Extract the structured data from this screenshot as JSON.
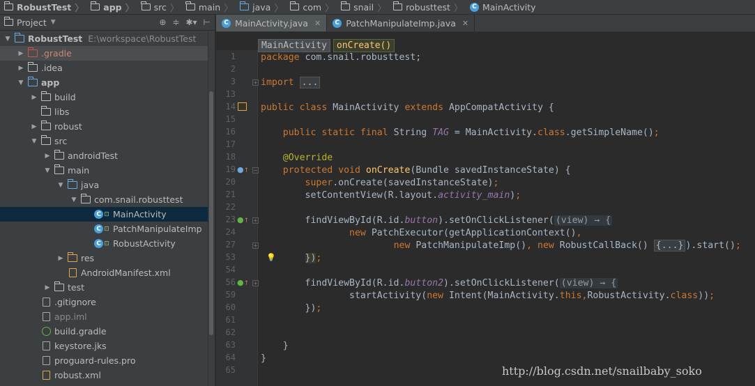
{
  "breadcrumbs": [
    {
      "label": "RobustTest",
      "icon": "project-folder-icon",
      "bold": true
    },
    {
      "label": "app",
      "icon": "module-folder-icon",
      "bold": true
    },
    {
      "label": "src",
      "icon": "folder-icon"
    },
    {
      "label": "main",
      "icon": "folder-icon"
    },
    {
      "label": "java",
      "icon": "source-folder-icon"
    },
    {
      "label": "com",
      "icon": "package-folder-icon"
    },
    {
      "label": "snail",
      "icon": "package-folder-icon"
    },
    {
      "label": "robusttest",
      "icon": "package-folder-icon"
    },
    {
      "label": "MainActivity",
      "icon": "class-icon"
    }
  ],
  "project": {
    "title": "Project",
    "tree": [
      {
        "depth": 0,
        "arrow": "down",
        "icon": "module",
        "label": "RobustTest",
        "bold": true,
        "path": "E:\\workspace\\RobustTest"
      },
      {
        "depth": 1,
        "arrow": "right",
        "icon": "folder-red",
        "label": ".gradle",
        "style": "red",
        "soft": true
      },
      {
        "depth": 1,
        "arrow": "right",
        "icon": "folder",
        "label": ".idea"
      },
      {
        "depth": 1,
        "arrow": "down",
        "icon": "module",
        "label": "app",
        "bold": true
      },
      {
        "depth": 2,
        "arrow": "right",
        "icon": "folder",
        "label": "build"
      },
      {
        "depth": 2,
        "arrow": "",
        "icon": "folder",
        "label": "libs"
      },
      {
        "depth": 2,
        "arrow": "right",
        "icon": "folder",
        "label": "robust"
      },
      {
        "depth": 2,
        "arrow": "down",
        "icon": "folder",
        "label": "src"
      },
      {
        "depth": 3,
        "arrow": "right",
        "icon": "folder",
        "label": "androidTest"
      },
      {
        "depth": 3,
        "arrow": "down",
        "icon": "folder",
        "label": "main"
      },
      {
        "depth": 4,
        "arrow": "down",
        "icon": "folder-blue",
        "label": "java"
      },
      {
        "depth": 5,
        "arrow": "down",
        "icon": "folder",
        "label": "com.snail.robusttest"
      },
      {
        "depth": 6,
        "arrow": "",
        "icon": "class",
        "label": "MainActivity",
        "selected": true
      },
      {
        "depth": 6,
        "arrow": "",
        "icon": "class",
        "label": "PatchManipulateImp"
      },
      {
        "depth": 6,
        "arrow": "",
        "icon": "class",
        "label": "RobustActivity"
      },
      {
        "depth": 4,
        "arrow": "right",
        "icon": "folder-orange",
        "label": "res"
      },
      {
        "depth": 4,
        "arrow": "",
        "icon": "xml",
        "label": "AndroidManifest.xml"
      },
      {
        "depth": 3,
        "arrow": "right",
        "icon": "folder",
        "label": "test"
      },
      {
        "depth": 2,
        "arrow": "",
        "icon": "file",
        "label": ".gitignore"
      },
      {
        "depth": 2,
        "arrow": "",
        "icon": "file",
        "label": "app.iml",
        "style": "gray"
      },
      {
        "depth": 2,
        "arrow": "",
        "icon": "gradle",
        "label": "build.gradle"
      },
      {
        "depth": 2,
        "arrow": "",
        "icon": "file",
        "label": "keystore.jks"
      },
      {
        "depth": 2,
        "arrow": "",
        "icon": "file",
        "label": "proguard-rules.pro"
      },
      {
        "depth": 2,
        "arrow": "",
        "icon": "xml",
        "label": "robust.xml"
      }
    ]
  },
  "editor": {
    "tabs": [
      {
        "label": "MainActivity.java",
        "active": true
      },
      {
        "label": "PatchManipulateImp.java",
        "active": false
      }
    ],
    "structure_crumbs": [
      "MainActivity",
      "onCreate()"
    ],
    "lines": [
      {
        "n": "1",
        "html": "<span class=\"kw\">package</span> com.snail.robusttest;"
      },
      {
        "n": "2",
        "html": ""
      },
      {
        "n": "3",
        "html": "<span class=\"kw\">import</span> <span class=\"fold\">...</span>",
        "fold": "+"
      },
      {
        "n": "13",
        "html": ""
      },
      {
        "n": "14",
        "html": "<span class=\"kw\">public class</span> MainActivity <span class=\"kw\">extends</span> AppCompatActivity {",
        "mark": "class-marker"
      },
      {
        "n": "15",
        "html": ""
      },
      {
        "n": "16",
        "html": "    <span class=\"kw\">public static final</span> String <span class=\"fl\">TAG</span> = MainActivity.<span class=\"kw\">class</span>.getSimpleName()<span class=\"kw\">;</span>"
      },
      {
        "n": "17",
        "html": ""
      },
      {
        "n": "18",
        "html": "    <span class=\"an\">@Override</span>"
      },
      {
        "n": "19",
        "html": "    <span class=\"kw\">protected void</span> <span class=\"fn\">onCreate</span>(Bundle savedInstanceState) {",
        "mark": "override",
        "fold": "-"
      },
      {
        "n": "20",
        "html": "        <span class=\"kw\">super</span>.onCreate(savedInstanceState)<span class=\"kw\">;</span>"
      },
      {
        "n": "21",
        "html": "        setContentView(R.layout.<span class=\"fl\">activity_main</span>)<span class=\"kw\">;</span>"
      },
      {
        "n": "22",
        "html": ""
      },
      {
        "n": "23",
        "html": "        findViewById(R.id.<span class=\"fl\">button</span>).setOnClickListener(<span class=\"lam\">(view) → {</span>",
        "mark": "impl",
        "fold": "+"
      },
      {
        "n": "24",
        "html": "                <span class=\"kw\">new</span> PatchExecutor(getApplicationContext()<span class=\"kw\">,</span>"
      },
      {
        "n": "27",
        "html": "                        <span class=\"kw\">new</span> PatchManipulateImp()<span class=\"kw\">, new</span> RobustCallBack() <span class=\"fold\">{...}</span>).start()<span class=\"kw\">;</span>",
        "fold": "+"
      },
      {
        "n": "53",
        "html": "        <span class=\"hl\">})</span><span class=\"kw\">;</span>",
        "mark": "bulb"
      },
      {
        "n": "54",
        "html": ""
      },
      {
        "n": "56",
        "html": "        findViewById(R.id.<span class=\"fl\">button2</span>).setOnClickListener(<span class=\"lam\">(view) → {</span>",
        "mark": "impl",
        "fold": "+"
      },
      {
        "n": "59",
        "html": "                startActivity(<span class=\"kw\">new</span> Intent(MainActivity.<span class=\"kw\">this,</span>RobustActivity.<span class=\"kw\">class</span>))<span class=\"kw\">;</span>"
      },
      {
        "n": "60",
        "html": "        })<span class=\"kw\">;</span>"
      },
      {
        "n": "61",
        "html": ""
      },
      {
        "n": "62",
        "html": ""
      },
      {
        "n": "63",
        "html": "    }"
      },
      {
        "n": "64",
        "html": "}"
      },
      {
        "n": "65",
        "html": ""
      }
    ]
  },
  "watermark": "http://blog.csdn.net/snailbaby_soko",
  "colors": {
    "keyword": "#cc7832",
    "annotation": "#bbb529",
    "method": "#ffc66d",
    "field": "#9876aa",
    "selection": "#0d293e"
  }
}
